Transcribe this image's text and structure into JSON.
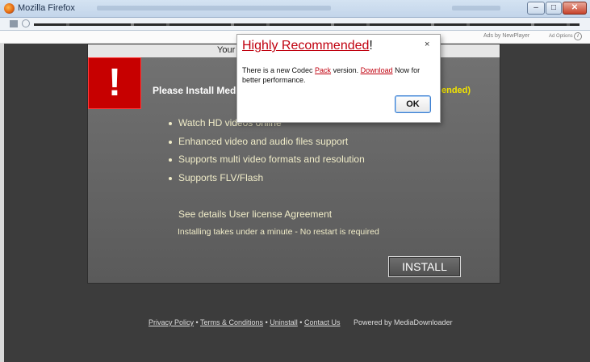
{
  "window": {
    "title": "Mozilla Firefox",
    "minimize_glyph": "‒",
    "maximize_glyph": "□",
    "close_glyph": "✕"
  },
  "ad_strip": {
    "ads_by": "Ads by NewPlayer",
    "ad_options": "Ad Options",
    "info_glyph": "i"
  },
  "panel": {
    "top_text": "Your",
    "alert_glyph": "!",
    "install_title": "Please Install Media",
    "recommended_tail": "ended)",
    "features": [
      "Watch HD videos online",
      "Enhanced video and audio files support",
      "Supports multi video formats and resolution",
      "Supports FLV/Flash"
    ],
    "details_link": "See details User license Agreement",
    "install_note": "Installing takes under a minute - No restart is required",
    "install_button": "INSTALL"
  },
  "footer": {
    "links": [
      "Privacy Policy",
      "Terms & Conditions",
      "Uninstall",
      "Contact Us"
    ],
    "separator": "•",
    "powered_by": "Powered by MediaDownloader"
  },
  "popup": {
    "title_red": "Highly Recommended",
    "title_suffix": "!",
    "close_glyph": "×",
    "body_part1": "There is a new Codec ",
    "body_link1": "Pack",
    "body_part2": " version. ",
    "body_link2": "Download",
    "body_part3": " Now for better performance.",
    "ok_button": "OK"
  },
  "colors": {
    "alert_red": "#c70000",
    "popup_accent_red": "#c0000e",
    "recommended_yellow": "#f2e400",
    "ok_border_blue": "#3b7ed0"
  }
}
